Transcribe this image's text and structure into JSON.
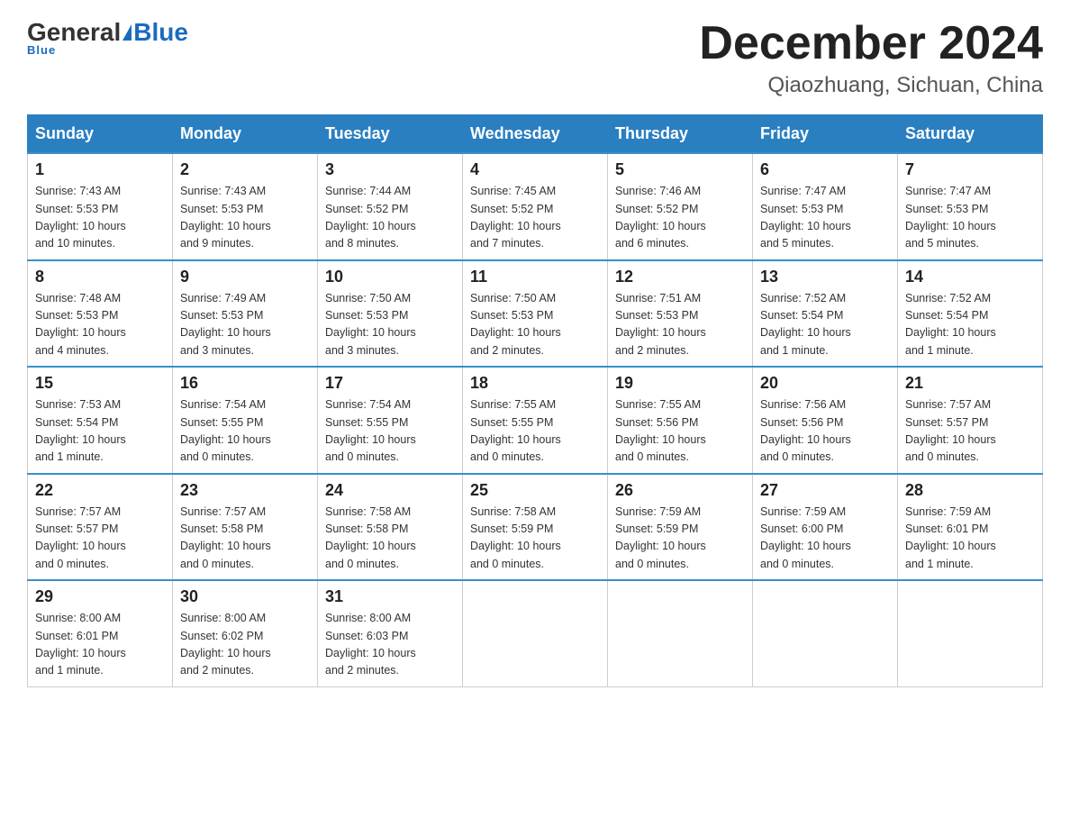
{
  "logo": {
    "general": "General",
    "blue": "Blue",
    "underline": "Blue"
  },
  "title": "December 2024",
  "location": "Qiaozhuang, Sichuan, China",
  "headers": [
    "Sunday",
    "Monday",
    "Tuesday",
    "Wednesday",
    "Thursday",
    "Friday",
    "Saturday"
  ],
  "weeks": [
    [
      {
        "num": "1",
        "info": "Sunrise: 7:43 AM\nSunset: 5:53 PM\nDaylight: 10 hours\nand 10 minutes."
      },
      {
        "num": "2",
        "info": "Sunrise: 7:43 AM\nSunset: 5:53 PM\nDaylight: 10 hours\nand 9 minutes."
      },
      {
        "num": "3",
        "info": "Sunrise: 7:44 AM\nSunset: 5:52 PM\nDaylight: 10 hours\nand 8 minutes."
      },
      {
        "num": "4",
        "info": "Sunrise: 7:45 AM\nSunset: 5:52 PM\nDaylight: 10 hours\nand 7 minutes."
      },
      {
        "num": "5",
        "info": "Sunrise: 7:46 AM\nSunset: 5:52 PM\nDaylight: 10 hours\nand 6 minutes."
      },
      {
        "num": "6",
        "info": "Sunrise: 7:47 AM\nSunset: 5:53 PM\nDaylight: 10 hours\nand 5 minutes."
      },
      {
        "num": "7",
        "info": "Sunrise: 7:47 AM\nSunset: 5:53 PM\nDaylight: 10 hours\nand 5 minutes."
      }
    ],
    [
      {
        "num": "8",
        "info": "Sunrise: 7:48 AM\nSunset: 5:53 PM\nDaylight: 10 hours\nand 4 minutes."
      },
      {
        "num": "9",
        "info": "Sunrise: 7:49 AM\nSunset: 5:53 PM\nDaylight: 10 hours\nand 3 minutes."
      },
      {
        "num": "10",
        "info": "Sunrise: 7:50 AM\nSunset: 5:53 PM\nDaylight: 10 hours\nand 3 minutes."
      },
      {
        "num": "11",
        "info": "Sunrise: 7:50 AM\nSunset: 5:53 PM\nDaylight: 10 hours\nand 2 minutes."
      },
      {
        "num": "12",
        "info": "Sunrise: 7:51 AM\nSunset: 5:53 PM\nDaylight: 10 hours\nand 2 minutes."
      },
      {
        "num": "13",
        "info": "Sunrise: 7:52 AM\nSunset: 5:54 PM\nDaylight: 10 hours\nand 1 minute."
      },
      {
        "num": "14",
        "info": "Sunrise: 7:52 AM\nSunset: 5:54 PM\nDaylight: 10 hours\nand 1 minute."
      }
    ],
    [
      {
        "num": "15",
        "info": "Sunrise: 7:53 AM\nSunset: 5:54 PM\nDaylight: 10 hours\nand 1 minute."
      },
      {
        "num": "16",
        "info": "Sunrise: 7:54 AM\nSunset: 5:55 PM\nDaylight: 10 hours\nand 0 minutes."
      },
      {
        "num": "17",
        "info": "Sunrise: 7:54 AM\nSunset: 5:55 PM\nDaylight: 10 hours\nand 0 minutes."
      },
      {
        "num": "18",
        "info": "Sunrise: 7:55 AM\nSunset: 5:55 PM\nDaylight: 10 hours\nand 0 minutes."
      },
      {
        "num": "19",
        "info": "Sunrise: 7:55 AM\nSunset: 5:56 PM\nDaylight: 10 hours\nand 0 minutes."
      },
      {
        "num": "20",
        "info": "Sunrise: 7:56 AM\nSunset: 5:56 PM\nDaylight: 10 hours\nand 0 minutes."
      },
      {
        "num": "21",
        "info": "Sunrise: 7:57 AM\nSunset: 5:57 PM\nDaylight: 10 hours\nand 0 minutes."
      }
    ],
    [
      {
        "num": "22",
        "info": "Sunrise: 7:57 AM\nSunset: 5:57 PM\nDaylight: 10 hours\nand 0 minutes."
      },
      {
        "num": "23",
        "info": "Sunrise: 7:57 AM\nSunset: 5:58 PM\nDaylight: 10 hours\nand 0 minutes."
      },
      {
        "num": "24",
        "info": "Sunrise: 7:58 AM\nSunset: 5:58 PM\nDaylight: 10 hours\nand 0 minutes."
      },
      {
        "num": "25",
        "info": "Sunrise: 7:58 AM\nSunset: 5:59 PM\nDaylight: 10 hours\nand 0 minutes."
      },
      {
        "num": "26",
        "info": "Sunrise: 7:59 AM\nSunset: 5:59 PM\nDaylight: 10 hours\nand 0 minutes."
      },
      {
        "num": "27",
        "info": "Sunrise: 7:59 AM\nSunset: 6:00 PM\nDaylight: 10 hours\nand 0 minutes."
      },
      {
        "num": "28",
        "info": "Sunrise: 7:59 AM\nSunset: 6:01 PM\nDaylight: 10 hours\nand 1 minute."
      }
    ],
    [
      {
        "num": "29",
        "info": "Sunrise: 8:00 AM\nSunset: 6:01 PM\nDaylight: 10 hours\nand 1 minute."
      },
      {
        "num": "30",
        "info": "Sunrise: 8:00 AM\nSunset: 6:02 PM\nDaylight: 10 hours\nand 2 minutes."
      },
      {
        "num": "31",
        "info": "Sunrise: 8:00 AM\nSunset: 6:03 PM\nDaylight: 10 hours\nand 2 minutes."
      },
      null,
      null,
      null,
      null
    ]
  ]
}
